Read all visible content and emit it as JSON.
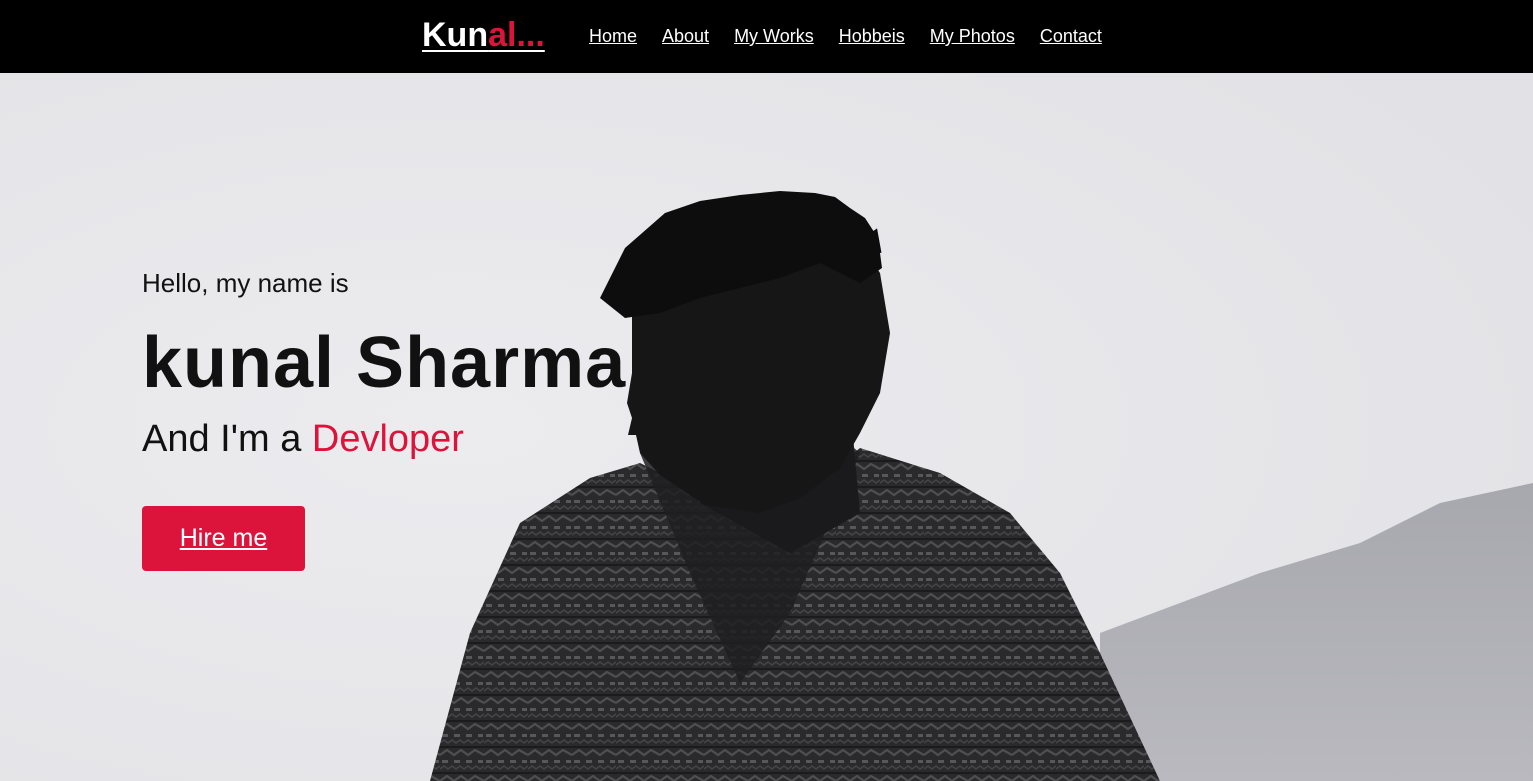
{
  "nav": {
    "logo_main": "Kun",
    "logo_accent": "al...",
    "items": [
      {
        "label": "Home"
      },
      {
        "label": "About"
      },
      {
        "label": "My Works"
      },
      {
        "label": "Hobbeis"
      },
      {
        "label": "My Photos"
      },
      {
        "label": "Contact"
      }
    ]
  },
  "hero": {
    "greeting": "Hello, my name is",
    "name": "kunal Sharma",
    "role_prefix": "And I'm a ",
    "role_highlight": "Devloper",
    "cta_label": "Hire me"
  },
  "colors": {
    "accent": "#dc143c",
    "nav_background": "#000000",
    "hero_background": "#e6e6e9",
    "text": "#111111"
  }
}
